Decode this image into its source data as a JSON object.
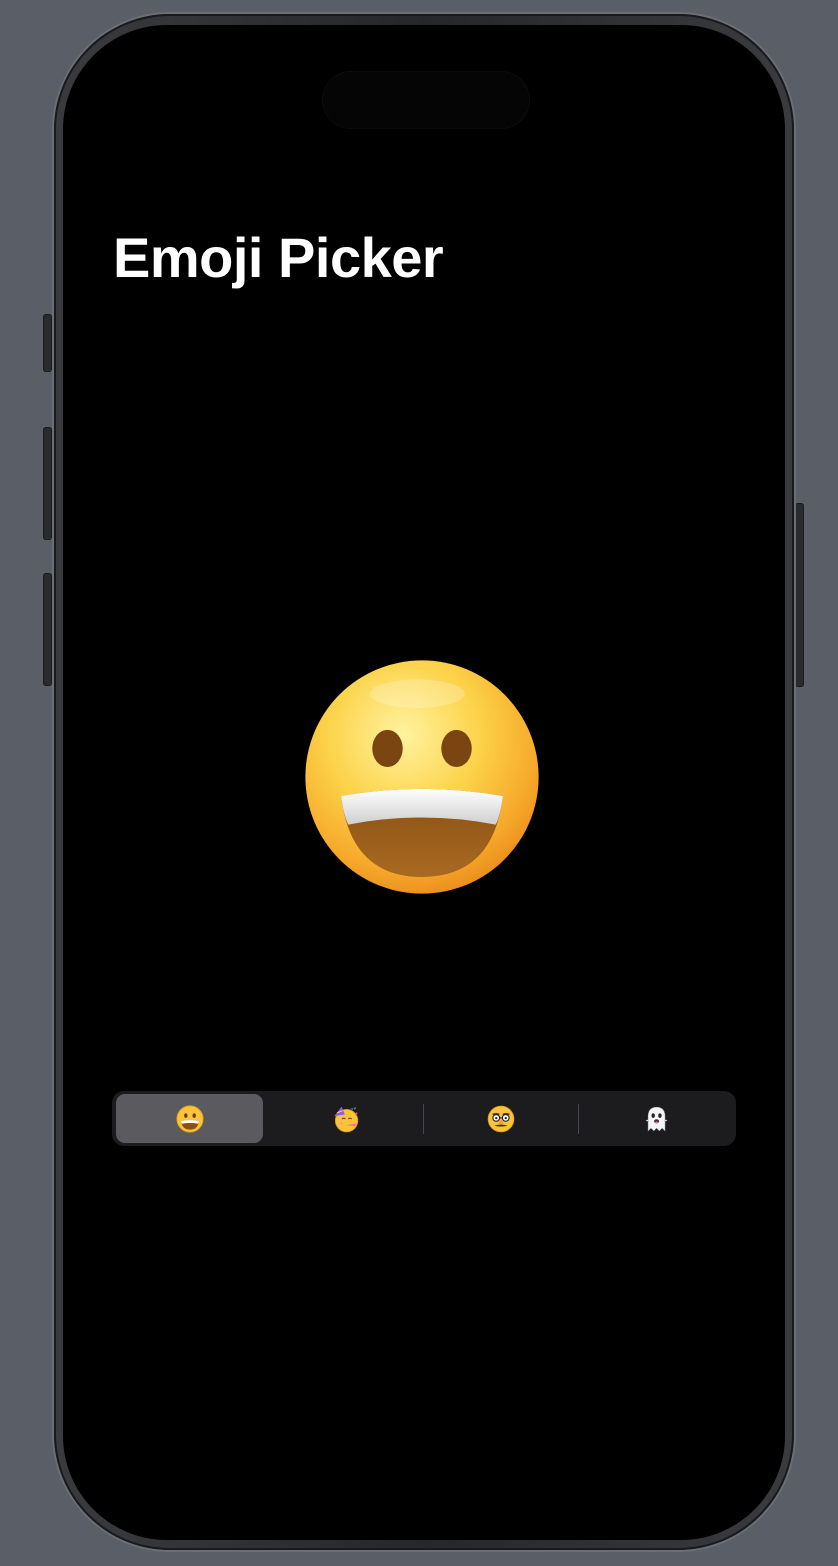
{
  "app": {
    "title": "Emoji Picker"
  },
  "selected_emoji": {
    "name": "grinning-face",
    "char": "😀"
  },
  "segmented_control": {
    "selected_index": 0,
    "options": [
      {
        "name": "grinning-face",
        "char": "😀"
      },
      {
        "name": "partying-face",
        "char": "🥳"
      },
      {
        "name": "disguised-face",
        "char": "🥸"
      },
      {
        "name": "ghost",
        "char": "👻"
      }
    ]
  },
  "colors": {
    "screen_background": "#000000",
    "segmented_background": "#1c1c1e",
    "segment_selected": "#5b5b5f",
    "title_text": "#ffffff"
  }
}
